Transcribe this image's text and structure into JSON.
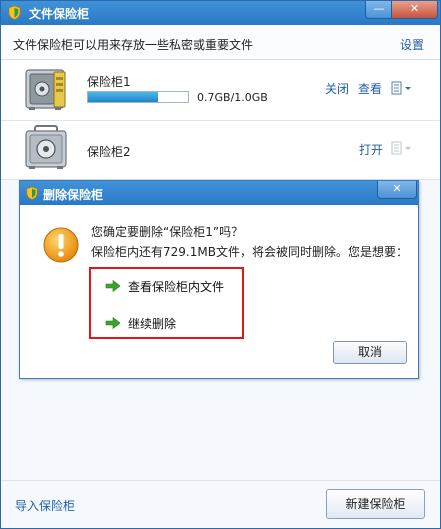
{
  "window": {
    "title": "文件保险柜",
    "minimize_symbol": "—",
    "close_symbol": "✕"
  },
  "description": {
    "text": "文件保险柜可以用来存放一些私密或重要文件",
    "settings_label": "设置"
  },
  "vaults": [
    {
      "name": "保险柜1",
      "state": "open",
      "capacity_text": "0.7GB/1.0GB",
      "capacity_fraction": 0.7,
      "action_close": "关闭",
      "action_view": "查看"
    },
    {
      "name": "保险柜2",
      "state": "locked",
      "action_open": "打开"
    }
  ],
  "dialog": {
    "title": "删除保险柜",
    "close_symbol": "✕",
    "confirm_text": "您确定要删除“保险柜1”吗？",
    "detail_text": "保险柜内还有729.1MB文件，将会被同时删除。您是想要：",
    "choice_view": "查看保险柜内文件",
    "choice_continue": "继续删除",
    "cancel_label": "取消"
  },
  "footer": {
    "import_label": "导入保险柜",
    "new_label": "新建保险柜"
  },
  "icons": {
    "app": "shield-icon",
    "safe_open": "open-safe-icon",
    "safe_locked": "locked-safe-icon",
    "warning": "warning-icon",
    "arrow": "green-arrow-icon"
  },
  "colors": {
    "title_bar": "#2a78c6",
    "link": "#1f5fa8",
    "highlight_box": "#e01818",
    "arrow": "#3aa52a",
    "warning": "#f2a01c"
  }
}
